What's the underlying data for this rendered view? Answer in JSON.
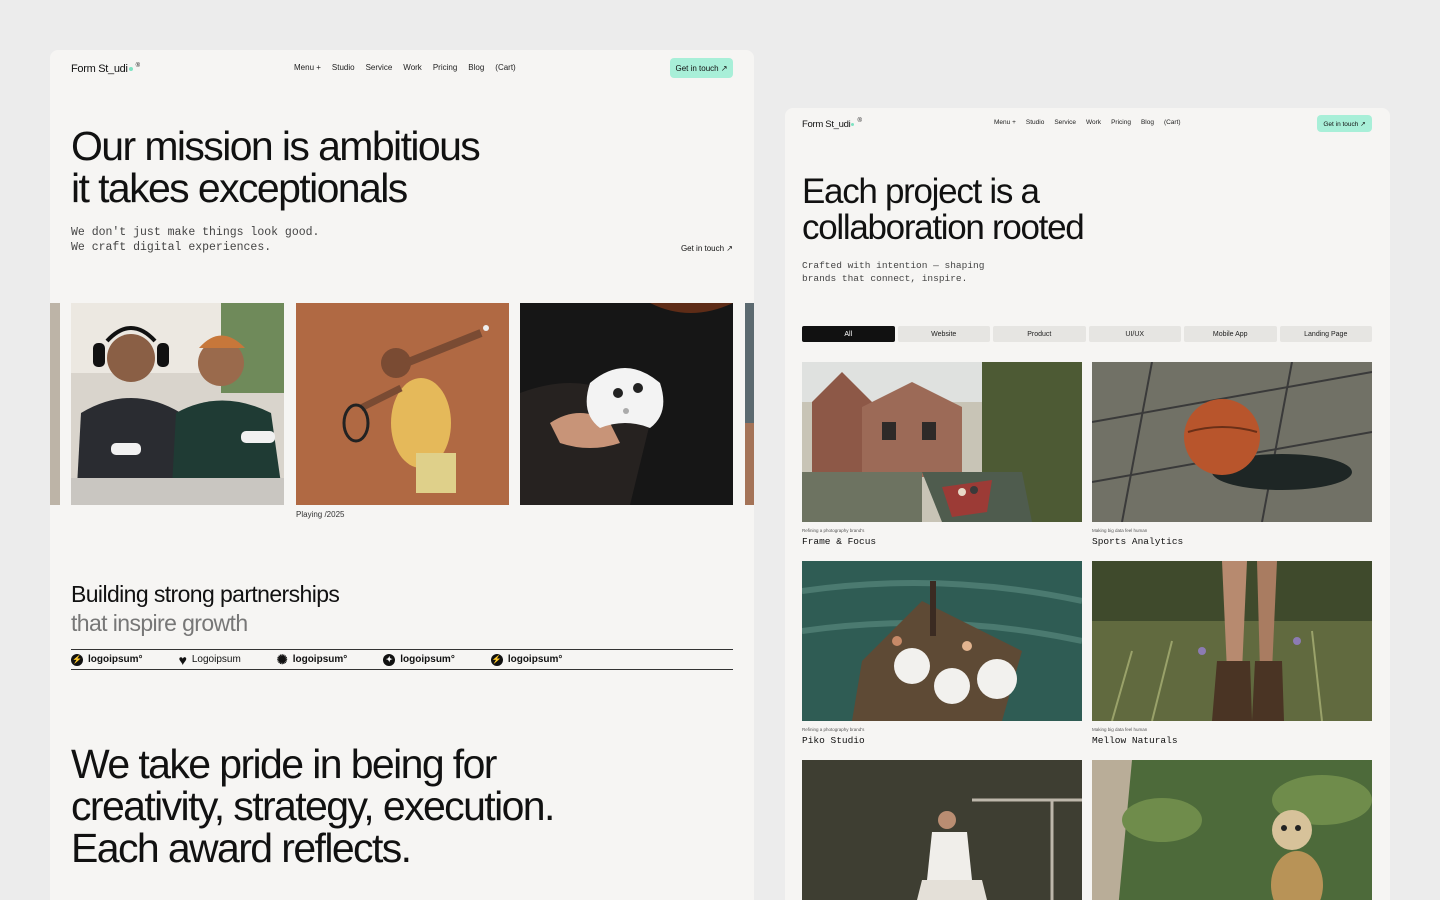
{
  "left": {
    "nav": {
      "logo": "Form St_udi",
      "logo_reg": "®",
      "menu": [
        "Menu +",
        "Studio",
        "Service",
        "Work",
        "Pricing",
        "Blog",
        "(Cart)"
      ],
      "cta": "Get in touch ↗"
    },
    "hero": {
      "title_line1": "Our mission is ambitious",
      "title_line2": "it takes exceptionals",
      "sub_line1": "We don't just make things look good.",
      "sub_line2": "We craft digital experiences.",
      "link": "Get in touch ↗"
    },
    "gallery": {
      "caption": "Playing /2025"
    },
    "partners": {
      "title": "Building strong partnerships",
      "title_muted": "that inspire growth",
      "logos": [
        {
          "icon": "bolt-icon",
          "label": "logoipsum°"
        },
        {
          "icon": "heart-icon",
          "label": "Logoipsum"
        },
        {
          "icon": "sun-icon",
          "label": "logoipsum°"
        },
        {
          "icon": "star-icon",
          "label": "logoipsum°"
        },
        {
          "icon": "bolt-icon",
          "label": "logoipsum°"
        }
      ]
    },
    "pride": {
      "line1": "We take pride in being for",
      "line2": "creativity, strategy, execution.",
      "line3": "Each award reflects."
    }
  },
  "right": {
    "nav": {
      "logo": "Form St_udi",
      "logo_reg": "®",
      "menu": [
        "Menu +",
        "Studio",
        "Service",
        "Work",
        "Pricing",
        "Blog",
        "(Cart)"
      ],
      "cta": "Get in touch ↗"
    },
    "hero": {
      "title_line1": "Each project is a",
      "title_line2": "collaboration rooted",
      "sub_line1": "Crafted with intention — shaping",
      "sub_line2": "brands that connect, inspire."
    },
    "filters": [
      "All",
      "Website",
      "Product",
      "UI/UX",
      "Mobile App",
      "Landing Page"
    ],
    "active_filter": "All",
    "projects": [
      {
        "kicker": "Refining a photography brand's",
        "title": "Frame & Focus"
      },
      {
        "kicker": "Making big data feel human",
        "title": "Sports Analytics"
      },
      {
        "kicker": "Refining a photography brand's",
        "title": "Piko Studio"
      },
      {
        "kicker": "Making big data feel human",
        "title": "Mellow Naturals"
      }
    ]
  },
  "colors": {
    "background": "#ececec",
    "card": "#f6f5f3",
    "accent": "#a8efd8",
    "text": "#111111"
  }
}
